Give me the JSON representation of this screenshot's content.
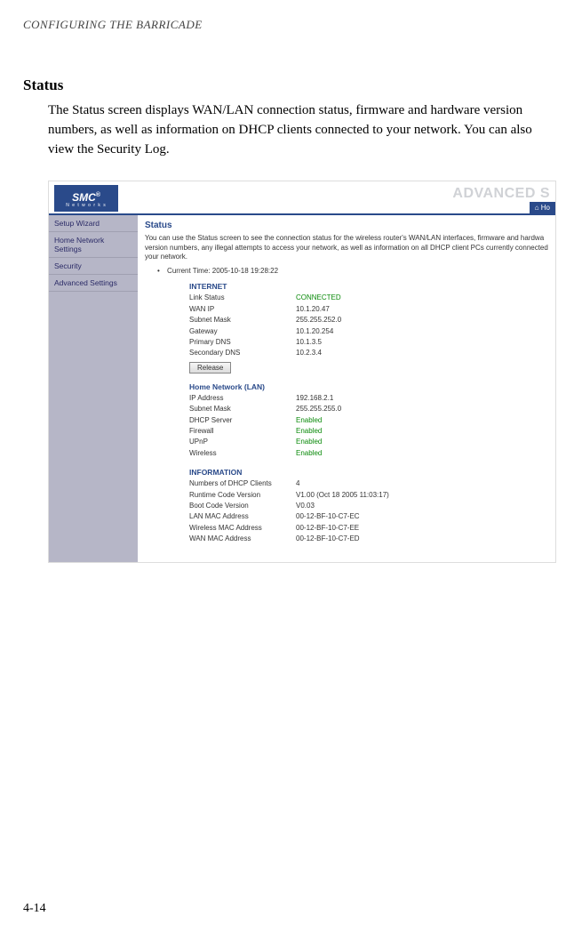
{
  "doc": {
    "header": "CONFIGURING THE BARRICADE",
    "section_title": "Status",
    "body": "The Status screen displays WAN/LAN connection status, firmware and hardware version numbers, as well as information on DHCP clients connected to your network. You can also view the Security Log.",
    "page_num": "4-14"
  },
  "ui": {
    "logo_main": "SMC",
    "logo_reg": "®",
    "logo_sub": "N e t w o r k s",
    "advanced_label": "ADVANCED S",
    "home_label": "Ho",
    "sidebar": {
      "items": [
        {
          "label": "Setup Wizard"
        },
        {
          "label": "Home Network Settings"
        },
        {
          "label": "Security"
        },
        {
          "label": "Advanced Settings"
        }
      ]
    },
    "main": {
      "title": "Status",
      "intro": "You can use the Status screen to see the connection status for the wireless router's WAN/LAN interfaces, firmware and hardwa version numbers, any illegal attempts to access your network, as well as information on all DHCP client PCs currently connected your network.",
      "current_time_label": "Current Time:",
      "current_time_value": "2005-10-18 19:28:22",
      "release_label": "Release",
      "groups": {
        "internet": {
          "title": "INTERNET",
          "rows": [
            {
              "k": "Link Status",
              "v": "CONNECTED",
              "green": true
            },
            {
              "k": "WAN IP",
              "v": "10.1.20.47"
            },
            {
              "k": "Subnet Mask",
              "v": "255.255.252.0"
            },
            {
              "k": "Gateway",
              "v": "10.1.20.254"
            },
            {
              "k": "Primary DNS",
              "v": "10.1.3.5"
            },
            {
              "k": "Secondary DNS",
              "v": "10.2.3.4"
            }
          ]
        },
        "lan": {
          "title": "Home Network (LAN)",
          "rows": [
            {
              "k": "IP Address",
              "v": "192.168.2.1"
            },
            {
              "k": "Subnet Mask",
              "v": "255.255.255.0"
            },
            {
              "k": "DHCP Server",
              "v": "Enabled",
              "green": true
            },
            {
              "k": "Firewall",
              "v": "Enabled",
              "green": true
            },
            {
              "k": "UPnP",
              "v": "Enabled",
              "green": true
            },
            {
              "k": "Wireless",
              "v": "Enabled",
              "green": true
            }
          ]
        },
        "info": {
          "title": "INFORMATION",
          "rows": [
            {
              "k": "Numbers of DHCP Clients",
              "v": "4"
            },
            {
              "k": "Runtime Code Version",
              "v": "V1.00 (Oct 18 2005 11:03:17)"
            },
            {
              "k": "Boot Code Version",
              "v": "V0.03"
            },
            {
              "k": "LAN MAC Address",
              "v": "00-12-BF-10-C7-EC"
            },
            {
              "k": "Wireless MAC Address",
              "v": "00-12-BF-10-C7-EE"
            },
            {
              "k": "WAN MAC Address",
              "v": "00-12-BF-10-C7-ED"
            }
          ]
        }
      }
    }
  }
}
